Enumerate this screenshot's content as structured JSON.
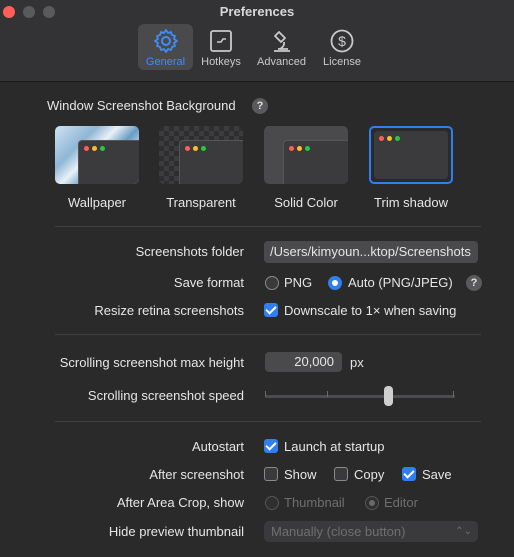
{
  "window": {
    "title": "Preferences"
  },
  "tabs": [
    {
      "label": "General",
      "icon": "gear-icon",
      "active": true
    },
    {
      "label": "Hotkeys",
      "icon": "keyboard-icon",
      "active": false
    },
    {
      "label": "Advanced",
      "icon": "microscope-icon",
      "active": false
    },
    {
      "label": "License",
      "icon": "dollar-icon",
      "active": false
    }
  ],
  "background": {
    "title": "Window Screenshot Background",
    "options": [
      {
        "label": "Wallpaper",
        "selected": false
      },
      {
        "label": "Transparent",
        "selected": false
      },
      {
        "label": "Solid Color",
        "selected": false
      },
      {
        "label": "Trim shadow",
        "selected": true
      }
    ]
  },
  "settings": {
    "folder_label": "Screenshots folder",
    "folder_value": "/Users/kimyoun...ktop/Screenshots",
    "format_label": "Save format",
    "format_png": "PNG",
    "format_auto": "Auto (PNG/JPEG)",
    "format_selected": "Auto (PNG/JPEG)",
    "retina_label": "Resize retina screenshots",
    "retina_option": "Downscale to 1× when saving",
    "retina_checked": true,
    "scroll_height_label": "Scrolling screenshot max height",
    "scroll_height_value": "20,000",
    "scroll_height_unit": "px",
    "scroll_speed_label": "Scrolling screenshot speed",
    "scroll_speed_level": 0.65,
    "autostart_label": "Autostart",
    "autostart_option": "Launch at startup",
    "autostart_checked": true,
    "after_label": "After screenshot",
    "after_show": "Show",
    "after_copy": "Copy",
    "after_save": "Save",
    "after_checked": {
      "show": false,
      "copy": false,
      "save": true
    },
    "area_crop_label": "After Area Crop, show",
    "area_crop_thumbnail": "Thumbnail",
    "area_crop_editor": "Editor",
    "area_crop_selected": "Editor",
    "preview_label": "Hide preview thumbnail",
    "preview_value": "Manually (close button)"
  },
  "colors": {
    "accent": "#2f7ff0",
    "active_tab_text": "#3d8ef7"
  }
}
